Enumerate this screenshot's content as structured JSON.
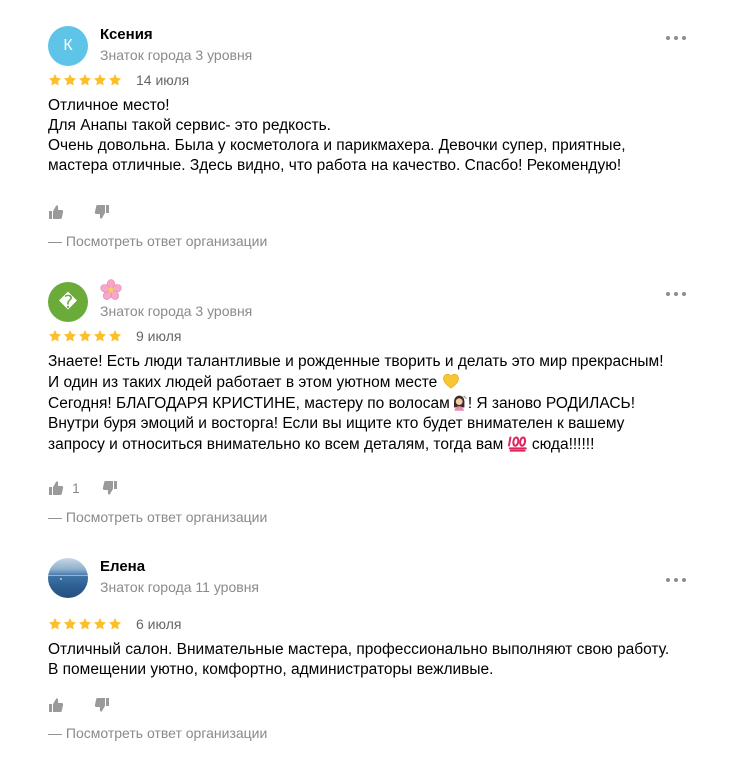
{
  "reviews": [
    {
      "avatar_letter": "К",
      "avatar_color": "#5ec4e8",
      "name": "Ксения",
      "level": "Знаток города 3 уровня",
      "rating": 5,
      "date": "14 июля",
      "lines": [
        "Отличное место!",
        "Для Анапы такой сервис- это редкость.",
        "Очень довольна. Была у косметолога и парикмахера. Девочки супер, приятные,",
        "мастера отличные. Здесь видно, что работа на качество. Спасбо! Рекомендую!"
      ],
      "likes": "",
      "reply_link": "— Посмотреть ответ организации"
    },
    {
      "avatar_letter": "�",
      "avatar_color": "#6bab3a",
      "name_icon": "cherry-blossom-icon",
      "level": "Знаток города 3 уровня",
      "rating": 5,
      "date": "9 июля",
      "lines": [
        "Знаете! Есть люди талантливые и рожденные творить и делать это мир прекрасным!",
        "И один из таких людей работает в этом уютном месте",
        "Сегодня! БЛАГОДАРЯ КРИСТИНЕ, мастеру по волосам",
        "! Я заново РОДИЛАСЬ!",
        "Внутри буря эмоций и восторга! Если вы ищите кто будет внимателен к вашему",
        "запросу и относиться внимательно ко всем деталям, тогда вам",
        " сюда!!!!!!"
      ],
      "likes": "1",
      "reply_link": "— Посмотреть ответ организации"
    },
    {
      "avatar_color": "#3f73a6",
      "name": "Елена",
      "level": "Знаток города 11 уровня",
      "rating": 5,
      "date": "6 июля",
      "lines": [
        "Отличный салон. Внимательные мастера, профессионально выполняют свою работу.",
        "В помещении уютно, комфортно, администраторы вежливые."
      ],
      "likes": "",
      "reply_link": "— Посмотреть ответ организации"
    }
  ],
  "colors": {
    "star": "#fcbf2b",
    "muted": "#8a8a8a"
  }
}
